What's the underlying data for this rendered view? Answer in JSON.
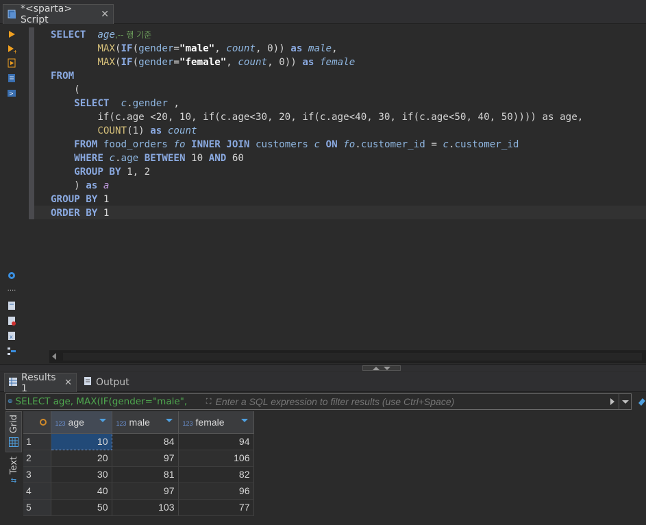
{
  "editor_tab": {
    "title": "*<sparta> Script",
    "close_glyph": "✕"
  },
  "code_lines": {
    "l1": {
      "kw": "SELECT",
      "col": "age",
      "cmt": ",-- 행 기준"
    },
    "l2": {
      "fn": "MAX",
      "fn2": "IF",
      "col": "gender",
      "str": "\"male\"",
      "alias1": "count",
      "num": "0",
      "kw": "as",
      "alias2": "male"
    },
    "l3": {
      "fn": "MAX",
      "fn2": "IF",
      "col": "gender",
      "str": "\"female\"",
      "alias1": "count",
      "num": "0",
      "kw": "as",
      "alias2": "female"
    },
    "l4": {
      "kw": "FROM"
    },
    "l5": {
      "text": "("
    },
    "l6": {
      "kw": "SELECT",
      "alias": "c",
      "col": "gender"
    },
    "l7": {
      "text": "if(c.age <20, 10, if(c.age<30, 20, if(c.age<40, 30, if(c.age<50, 40, 50)))) as age,"
    },
    "l8": {
      "fn": "COUNT",
      "num": "1",
      "kw": "as",
      "alias": "count"
    },
    "l9": {
      "kw1": "FROM",
      "tbl1": "food_orders",
      "a1": "fo",
      "kw2": "INNER JOIN",
      "tbl2": "customers",
      "a2": "c",
      "kw3": "ON",
      "a3": "fo",
      "c1": "customer_id",
      "a4": "c",
      "c2": "customer_id"
    },
    "l10": {
      "kw1": "WHERE",
      "alias": "c",
      "col": "age",
      "kw2": "BETWEEN",
      "n1": "10",
      "kw3": "AND",
      "n2": "60"
    },
    "l11": {
      "kw": "GROUP BY",
      "rest": "1, 2"
    },
    "l12": {
      "text": ")",
      "kw": "as",
      "alias": "a"
    },
    "l13": {
      "kw": "GROUP BY",
      "rest": "1"
    },
    "l14": {
      "kw": "ORDER BY",
      "rest": "1"
    }
  },
  "results_tabs": {
    "active": "Results 1",
    "inactive": "Output",
    "close_glyph": "✕"
  },
  "filter": {
    "query_preview": "SELECT age, MAX(IF(gender=\"male\",",
    "placeholder": "Enter a SQL expression to filter results (use Ctrl+Space)"
  },
  "side_tabs": {
    "grid": "Grid",
    "text": "Text"
  },
  "table": {
    "type_label": "123",
    "columns": [
      "age",
      "male",
      "female"
    ],
    "rows": [
      {
        "n": "1",
        "age": "10",
        "male": "84",
        "female": "94"
      },
      {
        "n": "2",
        "age": "20",
        "male": "97",
        "female": "106"
      },
      {
        "n": "3",
        "age": "30",
        "male": "81",
        "female": "82"
      },
      {
        "n": "4",
        "age": "40",
        "male": "97",
        "female": "96"
      },
      {
        "n": "5",
        "age": "50",
        "male": "103",
        "female": "77"
      }
    ]
  }
}
